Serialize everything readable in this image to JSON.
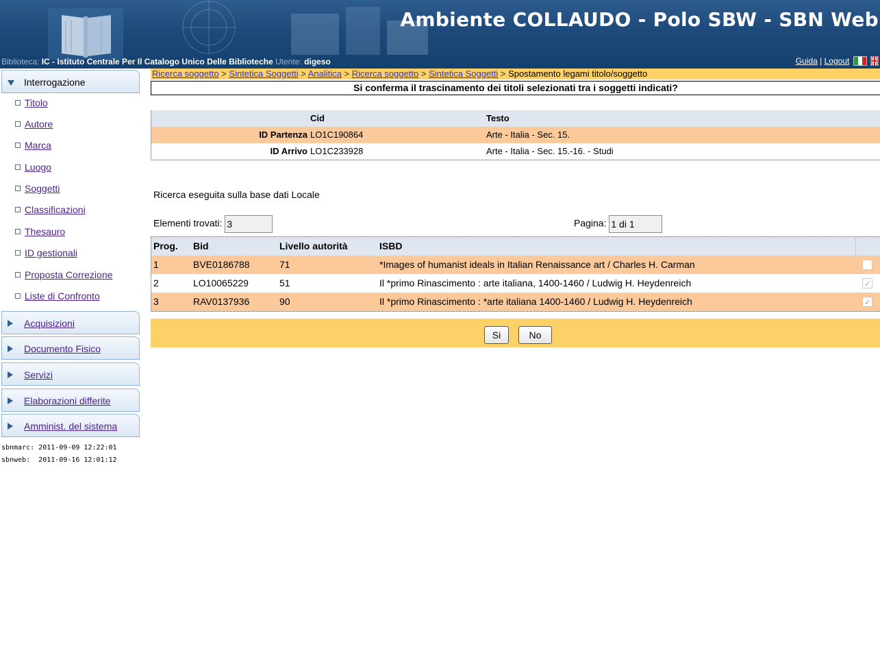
{
  "header": {
    "title": "Ambiente COLLAUDO - Polo SBW - SBN Web",
    "biblioteca_label": "Biblioteca:",
    "biblioteca_code": "IC",
    "biblioteca_name": " - Istituto Centrale Per Il Catalogo Unico Delle Biblioteche",
    "utente_label": "Utente:",
    "utente_value": "digeso",
    "guida_link": "Guida",
    "separator": "|",
    "logout_link": "Logout"
  },
  "sidebar": {
    "interrogazione": "Interrogazione",
    "items": [
      "Titolo",
      "Autore",
      "Marca",
      "Luogo",
      "Soggetti",
      "Classificazioni",
      "Thesauro",
      "ID gestionali",
      "Proposta Correzione",
      "Liste di Confronto"
    ],
    "sections": [
      "Acquisizioni",
      "Documento Fisico",
      "Servizi",
      "Elaborazioni differite",
      "Amminist. del sistema"
    ],
    "stamps": [
      "sbnmarc: 2011-09-09 12:22:01",
      "sbnweb:  2011-09-16 12:01:12"
    ]
  },
  "breadcrumb": {
    "links": [
      "Ricerca soggetto",
      "Sintetica Soggetti",
      "Analitica",
      "Ricerca soggetto",
      "Sintetica Soggetti"
    ],
    "separator": ">",
    "current": "Spostamento legami titolo/soggetto"
  },
  "confirm_message": "Si conferma il trascinamento dei titoli selezionati tra i soggetti indicati?",
  "ids_table": {
    "col_cid": "Cid",
    "col_testo": "Testo",
    "rows": [
      {
        "label": "ID Partenza",
        "cid": "LO1C190864",
        "testo": "Arte - Italia - Sec. 15."
      },
      {
        "label": "ID Arrivo",
        "cid": "LO1C233928",
        "testo": "Arte - Italia - Sec. 15.-16. - Studi"
      }
    ]
  },
  "db_note": "Ricerca eseguita sulla base dati Locale",
  "found_label": "Elementi trovati:",
  "found_value": "3",
  "page_label": "Pagina:",
  "page_value": "1 di 1",
  "results": {
    "headers": [
      "Prog.",
      "Bid",
      "Livello autorità",
      "ISBD"
    ],
    "rows": [
      {
        "prog": "1",
        "bid": "BVE0186788",
        "livello": "71",
        "isbd": "*Images of humanist ideals in Italian Renaissance art / Charles H. Carman",
        "checked": false
      },
      {
        "prog": "2",
        "bid": "LO10065229",
        "livello": "51",
        "isbd": "Il *primo Rinascimento : arte italiana, 1400-1460 / Ludwig H. Heydenreich",
        "checked": true
      },
      {
        "prog": "3",
        "bid": "RAV0137936",
        "livello": "90",
        "isbd": "Il *primo Rinascimento : *arte italiana 1400-1460 / Ludwig H. Heydenreich",
        "checked": true
      }
    ]
  },
  "buttons": {
    "si": "Si",
    "no": "No"
  },
  "colors": {
    "header_blue": "#1d4a7a",
    "orange_row": "#fbc99a",
    "yellow_bar": "#fcd268",
    "head_grey_blue": "#dfe6ef"
  }
}
